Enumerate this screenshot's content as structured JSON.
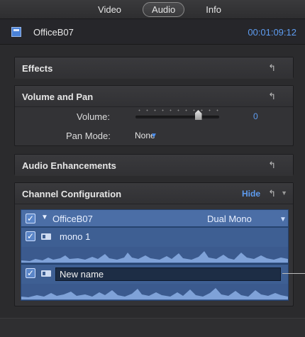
{
  "tabs": [
    {
      "label": "Video",
      "active": false
    },
    {
      "label": "Audio",
      "active": true
    },
    {
      "label": "Info",
      "active": false
    }
  ],
  "header": {
    "clip_name": "OfficeB07",
    "timecode": "00:01:09:12"
  },
  "sections": {
    "effects": {
      "title": "Effects"
    },
    "volume_pan": {
      "title": "Volume and Pan",
      "volume_label": "Volume:",
      "volume_value": "0",
      "volume_level": 0.75,
      "pan_mode_label": "Pan Mode:",
      "pan_mode_value": "None"
    },
    "audio_enhancements": {
      "title": "Audio Enhancements"
    },
    "channel_config": {
      "title": "Channel Configuration",
      "hide_label": "Hide",
      "clip": {
        "name": "OfficeB07",
        "mode": "Dual Mono",
        "checked": true
      },
      "channels": [
        {
          "name": "mono 1",
          "checked": true
        },
        {
          "name": "New name",
          "checked": true,
          "editing": true
        }
      ]
    }
  },
  "colors": {
    "accent": "#5e9cf0",
    "lane": "#3e5f93",
    "background": "#2b2b2d"
  },
  "icons": [
    "clip-icon",
    "reset-arrow-icon",
    "dropdown-caret-icon",
    "checkbox-icon",
    "channel-icon",
    "disclosure-triangle-icon"
  ]
}
